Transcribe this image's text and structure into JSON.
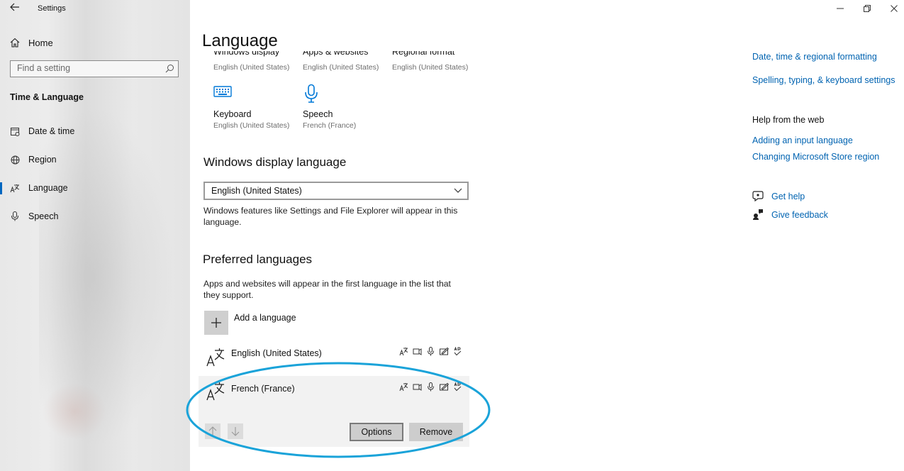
{
  "app": {
    "title": "Settings",
    "back_icon": "back-arrow-icon"
  },
  "nav": {
    "home_label": "Home",
    "search_placeholder": "Find a setting",
    "section_title": "Time & Language",
    "items": [
      {
        "label": "Date & time",
        "icon": "calendar-clock-icon",
        "active": false
      },
      {
        "label": "Region",
        "icon": "globe-icon",
        "active": false
      },
      {
        "label": "Language",
        "icon": "language-icon",
        "active": true
      },
      {
        "label": "Speech",
        "icon": "microphone-icon",
        "active": false
      }
    ],
    "accent_color": "#0067c0"
  },
  "window_controls": [
    "minimize",
    "restore",
    "close"
  ],
  "main": {
    "title": "Language",
    "tiles": [
      {
        "name": "Windows display",
        "sub": "English (United States)",
        "icon": "display-icon"
      },
      {
        "name": "Apps & websites",
        "sub": "English (United States)",
        "icon": "apps-icon"
      },
      {
        "name": "Regional format",
        "sub": "English (United States)",
        "icon": "regional-format-icon"
      },
      {
        "name": "Keyboard",
        "sub": "English (United States)",
        "icon": "keyboard-icon"
      },
      {
        "name": "Speech",
        "sub": "French (France)",
        "icon": "microphone-icon"
      }
    ],
    "display_language": {
      "heading": "Windows display language",
      "selected": "English (United States)",
      "description": "Windows features like Settings and File Explorer will appear in this language."
    },
    "preferred": {
      "heading": "Preferred languages",
      "description": "Apps and websites will appear in the first language in the list that they support.",
      "add_label": "Add a language",
      "languages": [
        {
          "name": "English (United States)",
          "selected": false
        },
        {
          "name": "French (France)",
          "selected": true
        }
      ],
      "feature_icons": [
        "display-language-icon",
        "text-to-speech-icon",
        "speech-recognition-icon",
        "handwriting-icon",
        "spellcheck-icon"
      ],
      "options_label": "Options",
      "remove_label": "Remove"
    }
  },
  "related": {
    "links": [
      "Date, time & regional formatting",
      "Spelling, typing, & keyboard settings"
    ],
    "help_heading": "Help from the web",
    "help_links": [
      "Adding an input language",
      "Changing Microsoft Store region"
    ],
    "get_help": "Get help",
    "give_feedback": "Give feedback",
    "link_color": "#0063b1"
  },
  "annotation": {
    "shape": "ellipse",
    "color": "#1aa3d9"
  }
}
